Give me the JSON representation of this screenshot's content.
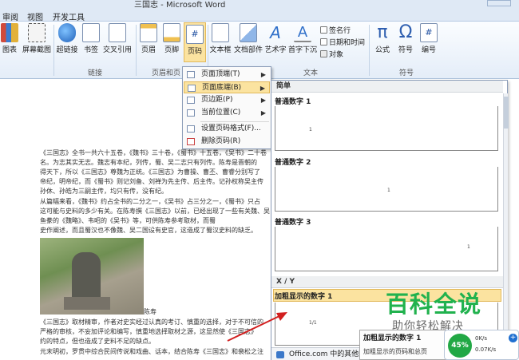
{
  "window": {
    "title": "三国志 - Microsoft Word"
  },
  "tabs": [
    "审阅",
    "视图",
    "开发工具"
  ],
  "ribbon": {
    "buttons": {
      "chart": "图表",
      "screenshot": "屏幕截图",
      "hyperlink": "超链接",
      "bookmark": "书签",
      "crossref": "交叉引用",
      "header": "页眉",
      "footer": "页脚",
      "pagenum": "页码",
      "textbox": "文本框",
      "quickparts": "文档部件",
      "wordart": "艺术字",
      "dropcap": "首字下沉",
      "signature": "签名行",
      "datetime": "日期和时间",
      "object": "对象",
      "equation": "公式",
      "symbol": "符号",
      "number": "编号"
    },
    "groups": {
      "links": "链接",
      "headerfooter": "页眉和页",
      "text": "文本",
      "symbols": "符号"
    }
  },
  "pagenum_menu": {
    "items": [
      {
        "label": "页面顶端(T)",
        "has_submenu": true
      },
      {
        "label": "页面底端(B)",
        "has_submenu": true,
        "highlighted": true
      },
      {
        "label": "页边距(P)",
        "has_submenu": true
      },
      {
        "label": "当前位置(C)",
        "has_submenu": true
      },
      {
        "label": "设置页码格式(F)...",
        "has_submenu": false
      },
      {
        "label": "删除页码(R)",
        "has_submenu": false
      }
    ]
  },
  "gallery": {
    "section_simple": "简单",
    "item1": "普通数字 1",
    "item2": "普通数字 2",
    "item3": "普通数字 3",
    "section_xy": "X / Y",
    "item_bold": "加粗显示的数字 1",
    "bold_preview": "1/1",
    "office_link": "Office.com 中的其他页码"
  },
  "tooltip": {
    "title": "加粗显示的数字 1",
    "desc": "加粗显示的页码和总页"
  },
  "watermark": {
    "line1": "百科全说",
    "line2": "助你轻松解决"
  },
  "net_widget": {
    "percent": "45%",
    "down": "0K/s",
    "up": "0.07K/s"
  },
  "document": {
    "lines": [
      "《三国志》全书一共六十五卷，《魏书》三十卷，《蜀书》十五卷，《吴书》二十卷",
      "名。为志其实无志。魏志有本纪，列传，蜀、吴二志只有列传。陈寿是晋朝的",
      "得天下，所以《三国志》尊魏为正统。《三国志》为曹操、曹丕、曹睿分别写了",
      "帝纪，明帝纪，而《蜀书》则记刘备、刘禅为先主传、后主传。记孙权称吴主传",
      "孙休、孙皓为三嗣主传，均只有传，没有纪。",
      "从篇幅来看，《魏书》约占全书的二分之一，《吴书》占三分之一，《蜀书》只占",
      "这可能与史料的多少有关。在陈寿撰《三国志》以前，已经出现了一些有关魏、吴",
      "鱼豢的《魏略》、韦昭的《吴书》等，可供陈寿参考取材，而蜀",
      "史作阐述，而且蜀汉也不像魏、吴二国设有史官，这造成了蜀汉史料的缺乏。"
    ],
    "caption": "陈寿",
    "bottom_lines": [
      "《三国志》取材精审，作者对史实经过认真的考订、慎重的选择，对于不可信的",
      "严格的审核，不妄加评论和编写，慎重地选择取材之源，这显然使《三国志》",
      "约的特点，但也造成了史料不足的缺点。",
      "元末明初，罗贯中综合民间传说和戏曲、话本，结合陈寿《三国志》和裴松之注"
    ]
  }
}
